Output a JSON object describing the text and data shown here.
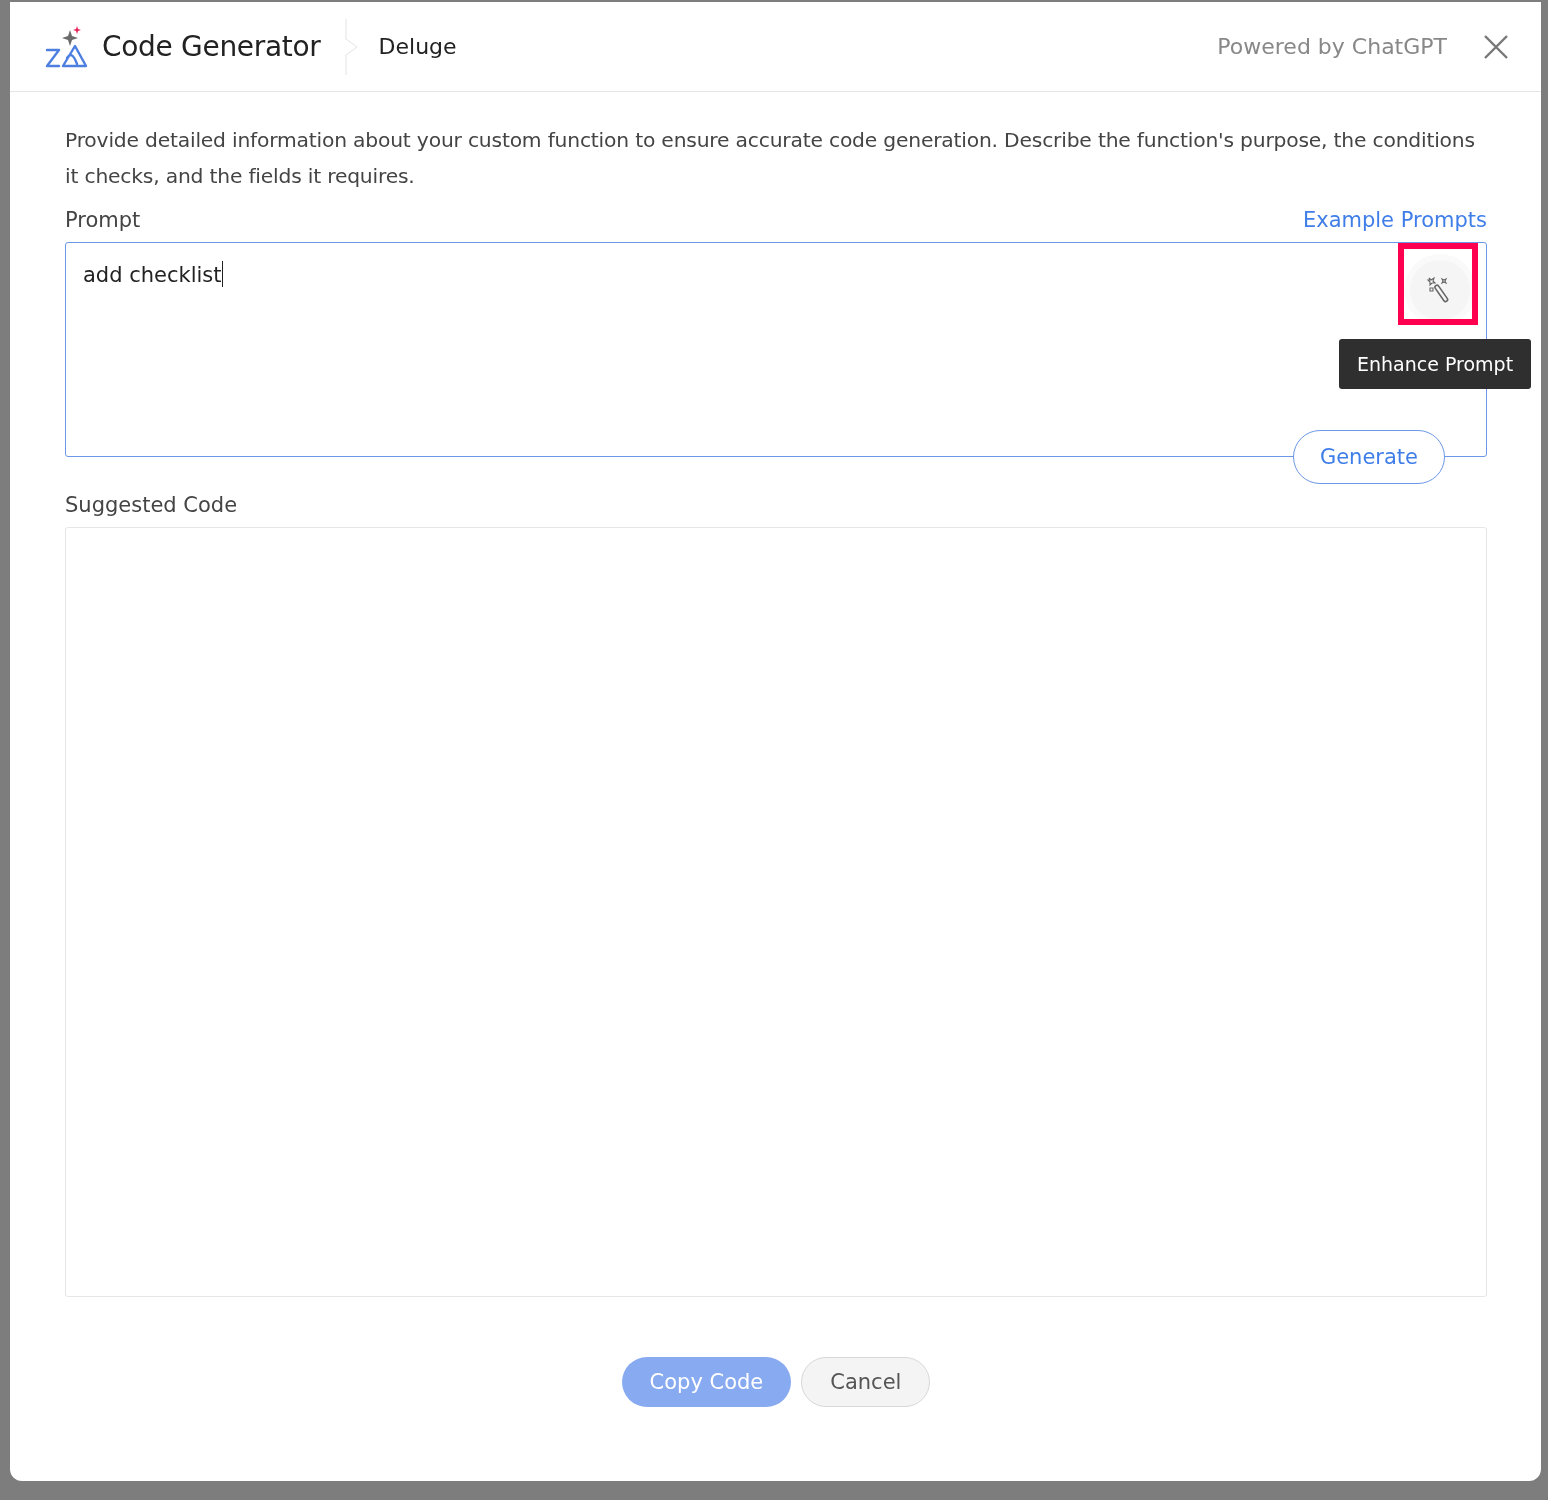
{
  "dialog": {
    "title": "Code Generator",
    "breadcrumb": "Deluge",
    "powered_by": "Powered by ChatGPT"
  },
  "description": "Provide detailed information about your custom function to ensure accurate code generation. Describe the function's purpose, the conditions it checks, and the fields it requires.",
  "prompt": {
    "label": "Prompt",
    "link": "Example Prompts",
    "value": "add checklist",
    "enhance": {
      "highlighted": true,
      "tooltip": "Enhance Prompt"
    },
    "generate": "Generate"
  },
  "suggested_code": {
    "label": "Suggested Code"
  },
  "buttons": [
    {
      "label": "Copy Code",
      "kind": "primary",
      "disabled": true
    },
    {
      "label": "Cancel",
      "kind": "secondary",
      "disabled": false
    }
  ]
}
